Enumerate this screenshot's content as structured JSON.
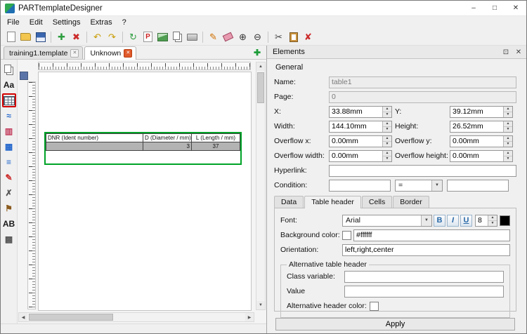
{
  "window": {
    "title": "PARTtemplateDesigner",
    "controls": {
      "minimize": "–",
      "maximize": "□",
      "close": "✕"
    }
  },
  "menu": {
    "items": [
      "File",
      "Edit",
      "Settings",
      "Extras",
      "?"
    ]
  },
  "toolbar": {
    "items": [
      {
        "name": "new-document-icon",
        "glyph": "doc"
      },
      {
        "name": "open-icon",
        "glyph": "folder"
      },
      {
        "name": "save-icon",
        "glyph": "floppy"
      },
      {
        "name": "separator"
      },
      {
        "name": "add-icon",
        "glyph": "✚",
        "color": "#2e9e3f"
      },
      {
        "name": "remove-icon",
        "glyph": "✖",
        "color": "#cc2b2b"
      },
      {
        "name": "separator"
      },
      {
        "name": "undo-icon",
        "glyph": "↶",
        "color": "#c89b00"
      },
      {
        "name": "redo-icon",
        "glyph": "↷",
        "color": "#c89b00"
      },
      {
        "name": "separator"
      },
      {
        "name": "refresh-icon",
        "glyph": "↻",
        "color": "#2e9e3f"
      },
      {
        "name": "export-pdf-icon",
        "glyph": "pdf"
      },
      {
        "name": "export-image-icon",
        "glyph": "img"
      },
      {
        "name": "copy-page-icon",
        "glyph": "copy"
      },
      {
        "name": "print-icon",
        "glyph": "print"
      },
      {
        "name": "separator"
      },
      {
        "name": "pencil-icon",
        "glyph": "✎",
        "color": "#d07000"
      },
      {
        "name": "eraser-icon",
        "glyph": "eraser"
      },
      {
        "name": "zoom-in-icon",
        "glyph": "⊕",
        "color": "#333333"
      },
      {
        "name": "zoom-out-icon",
        "glyph": "⊖",
        "color": "#333333"
      },
      {
        "name": "separator"
      },
      {
        "name": "cut-icon",
        "glyph": "✂",
        "color": "#444444"
      },
      {
        "name": "paste-icon",
        "glyph": "clipboard"
      },
      {
        "name": "delete-icon",
        "glyph": "✘",
        "color": "#cc2b2b"
      }
    ]
  },
  "document_tabs": {
    "tabs": [
      {
        "label": "training1.template"
      },
      {
        "label": "Unknown"
      }
    ],
    "active": "Unknown",
    "close_glyph": "✕",
    "add_label": "✚"
  },
  "sidebar": {
    "selected": "table-tool-icon",
    "tools": [
      {
        "name": "pages-tool-icon",
        "glyph": "copy"
      },
      {
        "name": "text-tool-icon",
        "glyph": "Aa",
        "color": "#1a1a1a"
      },
      {
        "name": "table-tool-icon",
        "glyph": "grid",
        "selected": true
      },
      {
        "name": "curve-tool-icon",
        "glyph": "≈",
        "color": "#2266cc"
      },
      {
        "name": "stamp-tool-icon",
        "glyph": "▥",
        "color": "#c23a5a"
      },
      {
        "name": "grid-tool-icon",
        "glyph": "▦",
        "color": "#2266cc"
      },
      {
        "name": "list-tool-icon",
        "glyph": "≡",
        "color": "#2266cc"
      },
      {
        "name": "pencil-tool-icon",
        "glyph": "✎",
        "color": "#cc2b2b"
      },
      {
        "name": "cross-tool-icon",
        "glyph": "✗",
        "color": "#555555"
      },
      {
        "name": "pin-tool-icon",
        "glyph": "⚑",
        "color": "#8a5a1e"
      },
      {
        "name": "label-tool-icon",
        "glyph": "AB",
        "color": "#1a1a1a"
      },
      {
        "name": "cells-tool-icon",
        "glyph": "▩",
        "color": "#555555"
      }
    ]
  },
  "canvas": {
    "scroll": {
      "up": "▲",
      "down": "▼",
      "left": "◀",
      "right": "▶"
    },
    "table": {
      "columns": [
        {
          "header": "DNR (Ident number)",
          "value": "",
          "align": "left"
        },
        {
          "header": "D (Diameter / mm)",
          "value": "3",
          "align": "right"
        },
        {
          "header": "L (Length / mm)",
          "value": "37",
          "align": "center"
        }
      ]
    }
  },
  "panel": {
    "title": "Elements",
    "header_icons": {
      "float": "⊡",
      "close": "✕"
    },
    "sections": {
      "general": "General"
    },
    "fields": {
      "name": {
        "label": "Name:",
        "value": "table1"
      },
      "page": {
        "label": "Page:",
        "value": "0"
      },
      "x": {
        "label": "X:",
        "value": "33.88mm"
      },
      "y": {
        "label": "Y:",
        "value": "39.12mm"
      },
      "width": {
        "label": "Width:",
        "value": "144.10mm"
      },
      "height": {
        "label": "Height:",
        "value": "26.52mm"
      },
      "overflow_x": {
        "label": "Overflow x:",
        "value": "0.00mm"
      },
      "overflow_y": {
        "label": "Overflow y:",
        "value": "0.00mm"
      },
      "overflow_width": {
        "label": "Overflow width:",
        "value": "0.00mm"
      },
      "overflow_height": {
        "label": "Overflow height:",
        "value": "0.00mm"
      },
      "hyperlink": {
        "label": "Hyperlink:",
        "value": ""
      },
      "condition": {
        "label": "Condition:",
        "value": "",
        "operator": "=",
        "value2": ""
      }
    },
    "tabs": {
      "items": [
        "Data",
        "Table header",
        "Cells",
        "Border"
      ],
      "active": "Table header"
    },
    "table_header_tab": {
      "font": {
        "label": "Font:",
        "value": "Arial",
        "size": "8",
        "color": "#000000",
        "style_buttons": [
          {
            "name": "bold-button",
            "label": "B"
          },
          {
            "name": "italic-button",
            "label": "I"
          },
          {
            "name": "underline-button",
            "label": "U"
          }
        ]
      },
      "background_color": {
        "label": "Background color:",
        "value": "#ffffff"
      },
      "orientation": {
        "label": "Orientation:",
        "value": "left,right,center"
      },
      "alternative": {
        "title": "Alternative table header",
        "class_variable": {
          "label": "Class variable:",
          "value": ""
        },
        "value": {
          "label": "Value",
          "value": ""
        },
        "color": {
          "label": "Alternative header color:"
        }
      }
    },
    "apply_label": "Apply"
  },
  "colors": {
    "selection_green": "#00a327",
    "tool_highlight_red": "#d20000",
    "active_tab_close": "#e05a2b",
    "add_tab_green": "#1f9d3a"
  }
}
